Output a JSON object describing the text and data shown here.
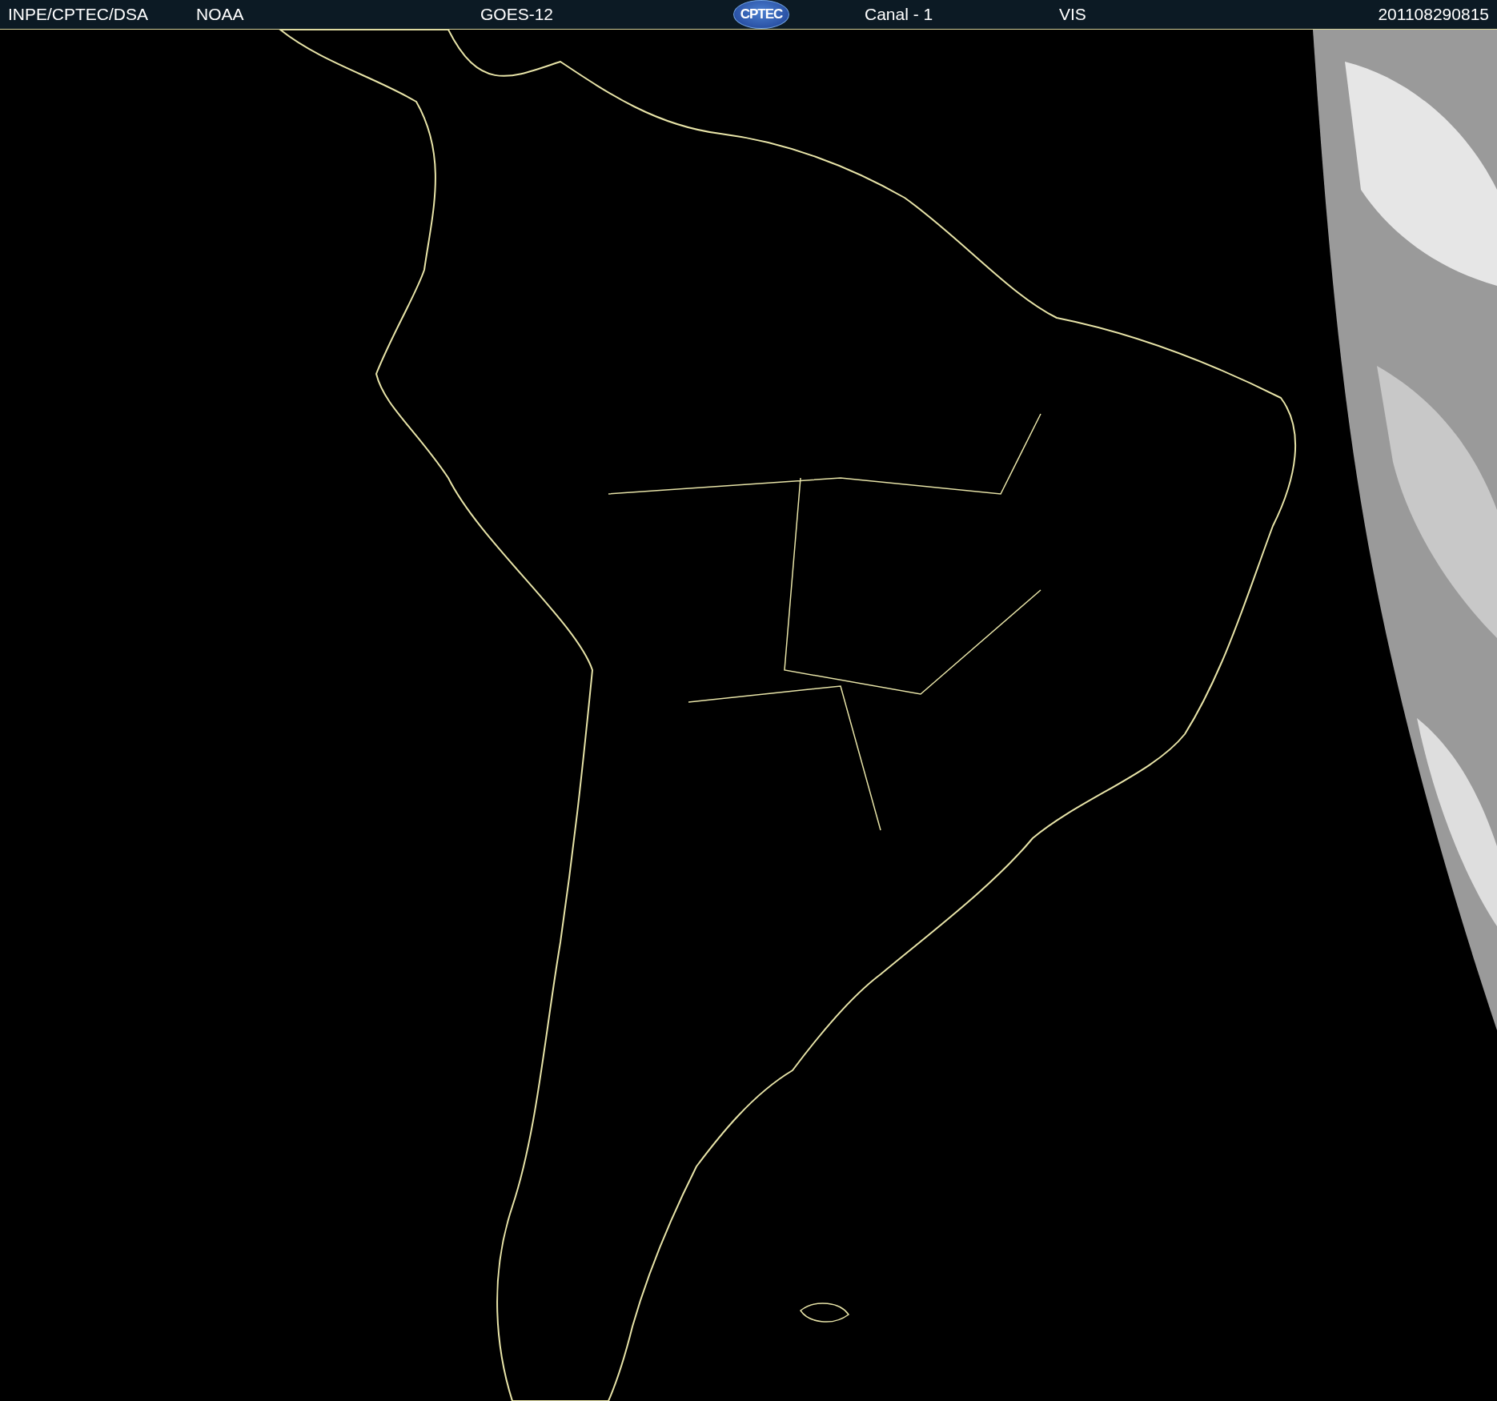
{
  "header": {
    "items": [
      {
        "kind": "text",
        "label": "INPE/CPTEC/DSA"
      },
      {
        "kind": "text",
        "label": "NOAA"
      },
      {
        "kind": "text",
        "label": "GOES-12"
      },
      {
        "kind": "logo",
        "label": "CPTEC"
      },
      {
        "kind": "text",
        "label": "Canal - 1"
      },
      {
        "kind": "text",
        "label": "VIS"
      },
      {
        "kind": "text",
        "label": "201108290815"
      }
    ]
  }
}
